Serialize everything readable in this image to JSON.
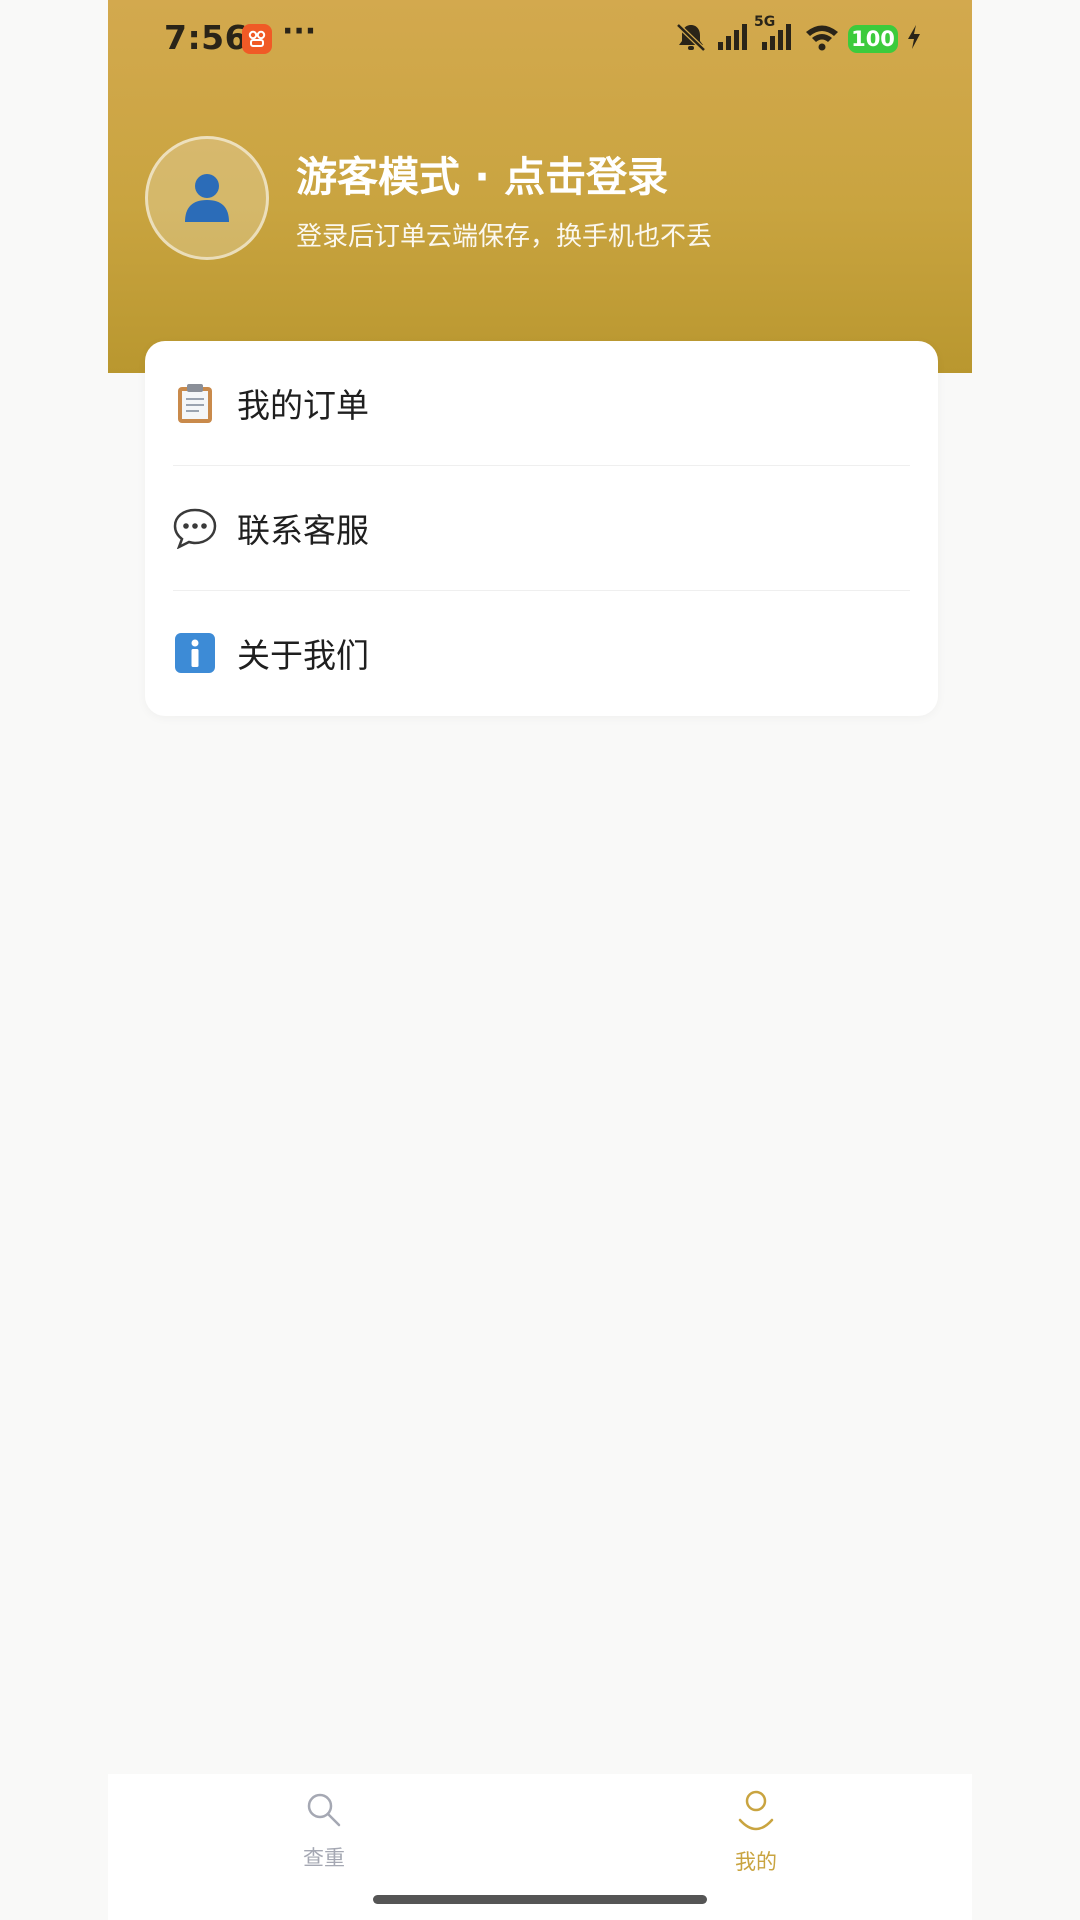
{
  "status_bar": {
    "time": "7:56",
    "more": "···",
    "network_label": "5G",
    "battery": "100"
  },
  "profile": {
    "title": "游客模式 · 点击登录",
    "subtitle": "登录后订单云端保存，换手机也不丢",
    "avatar_icon": "user-silhouette-icon"
  },
  "menu": {
    "items": [
      {
        "label": "我的订单",
        "icon": "clipboard-icon"
      },
      {
        "label": "联系客服",
        "icon": "speech-bubble-icon"
      },
      {
        "label": "关于我们",
        "icon": "info-icon"
      }
    ]
  },
  "bottom_nav": {
    "items": [
      {
        "label": "查重",
        "icon": "search-icon",
        "active": false
      },
      {
        "label": "我的",
        "icon": "profile-icon",
        "active": true
      }
    ],
    "active_color": "#c9a440",
    "inactive_color": "#a5a8b3"
  },
  "colors": {
    "header_gradient_top": "#d3a94e",
    "header_gradient_bottom": "#b9972f"
  }
}
